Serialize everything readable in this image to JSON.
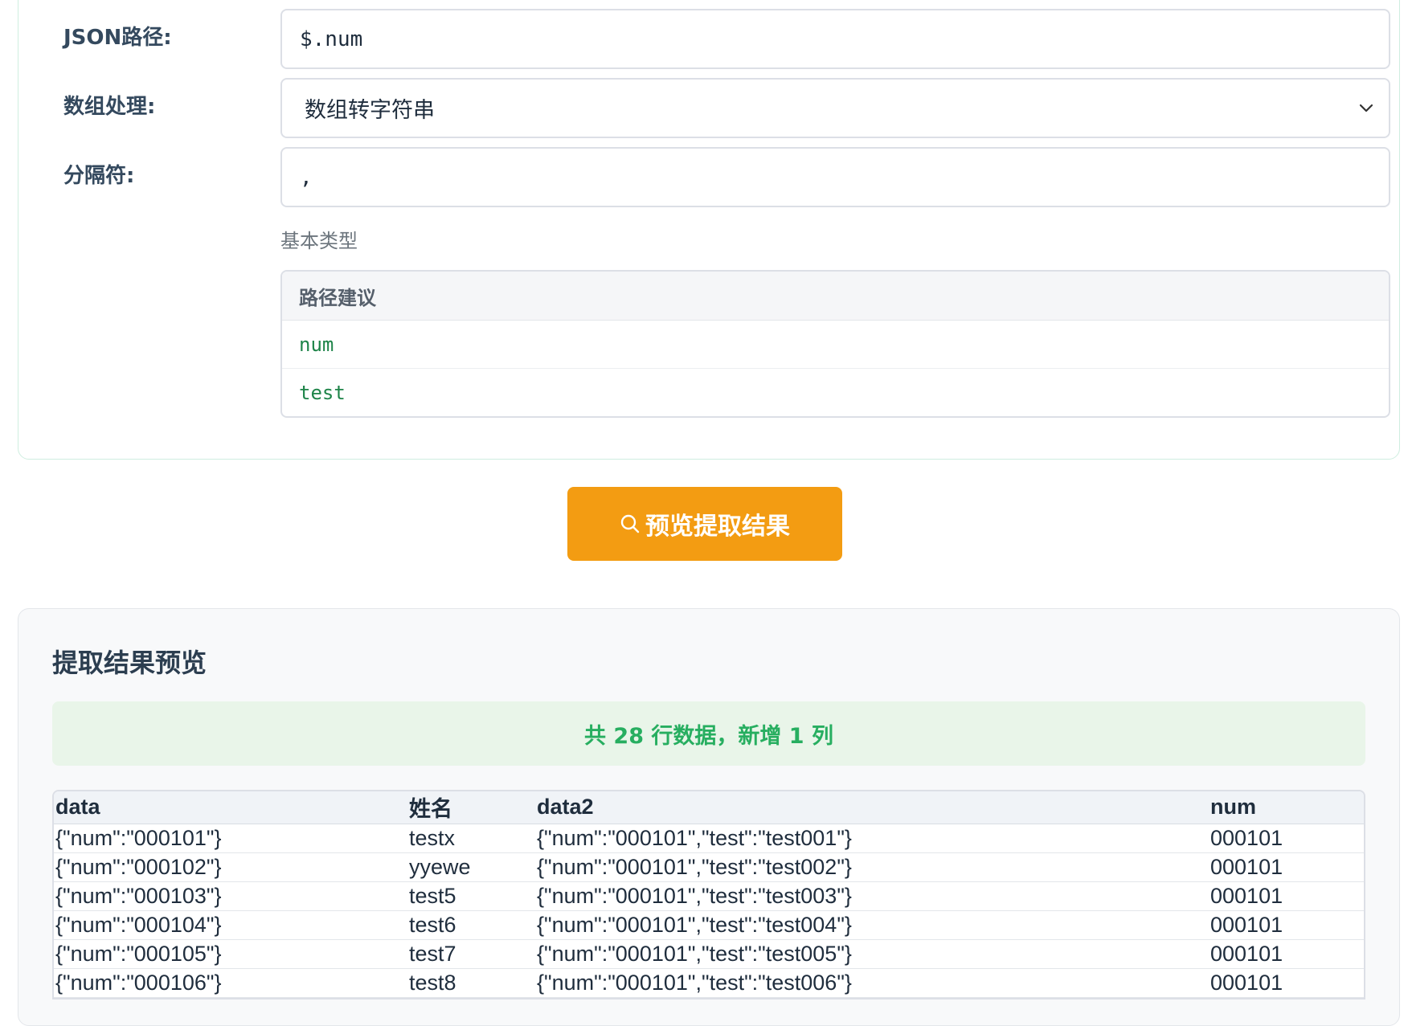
{
  "config": {
    "json_path": {
      "label": "JSON路径:",
      "value": "$.num"
    },
    "array_handling": {
      "label": "数组处理:",
      "selected": "数组转字符串"
    },
    "separator": {
      "label": "分隔符:",
      "value": ","
    },
    "type_hint": "基本类型",
    "suggestions": {
      "header": "路径建议",
      "items": [
        "num",
        "test"
      ]
    }
  },
  "preview_button": {
    "label": "预览提取结果",
    "color": "#f39c12"
  },
  "result": {
    "title": "提取结果预览",
    "summary": "共 28 行数据，新增 1 列",
    "columns": [
      "data",
      "姓名",
      "data2",
      "num"
    ],
    "rows": [
      [
        "{\"num\":\"000101\"}",
        "testx",
        "{\"num\":\"000101\",\"test\":\"test001\"}",
        "000101"
      ],
      [
        "{\"num\":\"000102\"}",
        "yyewe",
        "{\"num\":\"000101\",\"test\":\"test002\"}",
        "000101"
      ],
      [
        "{\"num\":\"000103\"}",
        "test5",
        "{\"num\":\"000101\",\"test\":\"test003\"}",
        "000101"
      ],
      [
        "{\"num\":\"000104\"}",
        "test6",
        "{\"num\":\"000101\",\"test\":\"test004\"}",
        "000101"
      ],
      [
        "{\"num\":\"000105\"}",
        "test7",
        "{\"num\":\"000101\",\"test\":\"test005\"}",
        "000101"
      ],
      [
        "{\"num\":\"000106\"}",
        "test8",
        "{\"num\":\"000101\",\"test\":\"test006\"}",
        "000101"
      ]
    ]
  },
  "icons": {
    "select_arrow": "chevron-down-icon",
    "preview": "search-icon"
  }
}
